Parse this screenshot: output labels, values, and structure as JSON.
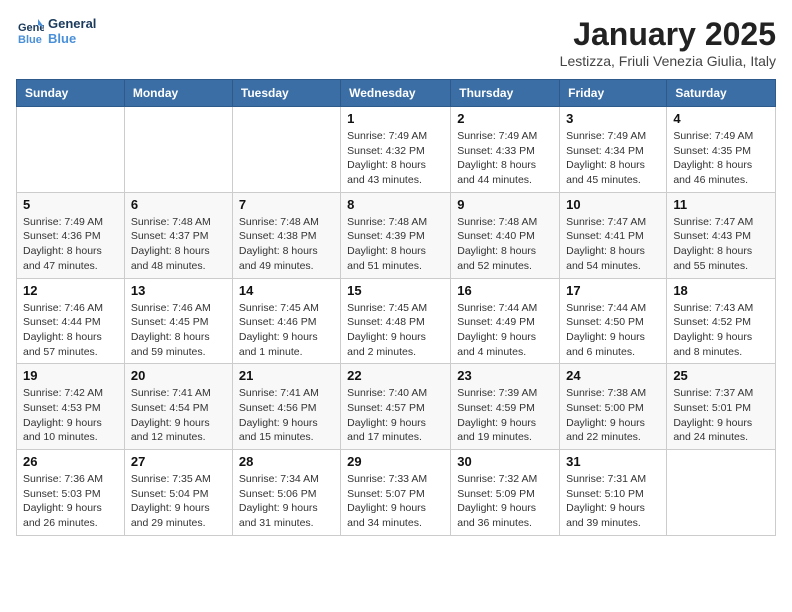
{
  "header": {
    "logo_line1": "General",
    "logo_line2": "Blue",
    "title": "January 2025",
    "subtitle": "Lestizza, Friuli Venezia Giulia, Italy"
  },
  "days_of_week": [
    "Sunday",
    "Monday",
    "Tuesday",
    "Wednesday",
    "Thursday",
    "Friday",
    "Saturday"
  ],
  "weeks": [
    [
      {
        "day": "",
        "info": ""
      },
      {
        "day": "",
        "info": ""
      },
      {
        "day": "",
        "info": ""
      },
      {
        "day": "1",
        "info": "Sunrise: 7:49 AM\nSunset: 4:32 PM\nDaylight: 8 hours and 43 minutes."
      },
      {
        "day": "2",
        "info": "Sunrise: 7:49 AM\nSunset: 4:33 PM\nDaylight: 8 hours and 44 minutes."
      },
      {
        "day": "3",
        "info": "Sunrise: 7:49 AM\nSunset: 4:34 PM\nDaylight: 8 hours and 45 minutes."
      },
      {
        "day": "4",
        "info": "Sunrise: 7:49 AM\nSunset: 4:35 PM\nDaylight: 8 hours and 46 minutes."
      }
    ],
    [
      {
        "day": "5",
        "info": "Sunrise: 7:49 AM\nSunset: 4:36 PM\nDaylight: 8 hours and 47 minutes."
      },
      {
        "day": "6",
        "info": "Sunrise: 7:48 AM\nSunset: 4:37 PM\nDaylight: 8 hours and 48 minutes."
      },
      {
        "day": "7",
        "info": "Sunrise: 7:48 AM\nSunset: 4:38 PM\nDaylight: 8 hours and 49 minutes."
      },
      {
        "day": "8",
        "info": "Sunrise: 7:48 AM\nSunset: 4:39 PM\nDaylight: 8 hours and 51 minutes."
      },
      {
        "day": "9",
        "info": "Sunrise: 7:48 AM\nSunset: 4:40 PM\nDaylight: 8 hours and 52 minutes."
      },
      {
        "day": "10",
        "info": "Sunrise: 7:47 AM\nSunset: 4:41 PM\nDaylight: 8 hours and 54 minutes."
      },
      {
        "day": "11",
        "info": "Sunrise: 7:47 AM\nSunset: 4:43 PM\nDaylight: 8 hours and 55 minutes."
      }
    ],
    [
      {
        "day": "12",
        "info": "Sunrise: 7:46 AM\nSunset: 4:44 PM\nDaylight: 8 hours and 57 minutes."
      },
      {
        "day": "13",
        "info": "Sunrise: 7:46 AM\nSunset: 4:45 PM\nDaylight: 8 hours and 59 minutes."
      },
      {
        "day": "14",
        "info": "Sunrise: 7:45 AM\nSunset: 4:46 PM\nDaylight: 9 hours and 1 minute."
      },
      {
        "day": "15",
        "info": "Sunrise: 7:45 AM\nSunset: 4:48 PM\nDaylight: 9 hours and 2 minutes."
      },
      {
        "day": "16",
        "info": "Sunrise: 7:44 AM\nSunset: 4:49 PM\nDaylight: 9 hours and 4 minutes."
      },
      {
        "day": "17",
        "info": "Sunrise: 7:44 AM\nSunset: 4:50 PM\nDaylight: 9 hours and 6 minutes."
      },
      {
        "day": "18",
        "info": "Sunrise: 7:43 AM\nSunset: 4:52 PM\nDaylight: 9 hours and 8 minutes."
      }
    ],
    [
      {
        "day": "19",
        "info": "Sunrise: 7:42 AM\nSunset: 4:53 PM\nDaylight: 9 hours and 10 minutes."
      },
      {
        "day": "20",
        "info": "Sunrise: 7:41 AM\nSunset: 4:54 PM\nDaylight: 9 hours and 12 minutes."
      },
      {
        "day": "21",
        "info": "Sunrise: 7:41 AM\nSunset: 4:56 PM\nDaylight: 9 hours and 15 minutes."
      },
      {
        "day": "22",
        "info": "Sunrise: 7:40 AM\nSunset: 4:57 PM\nDaylight: 9 hours and 17 minutes."
      },
      {
        "day": "23",
        "info": "Sunrise: 7:39 AM\nSunset: 4:59 PM\nDaylight: 9 hours and 19 minutes."
      },
      {
        "day": "24",
        "info": "Sunrise: 7:38 AM\nSunset: 5:00 PM\nDaylight: 9 hours and 22 minutes."
      },
      {
        "day": "25",
        "info": "Sunrise: 7:37 AM\nSunset: 5:01 PM\nDaylight: 9 hours and 24 minutes."
      }
    ],
    [
      {
        "day": "26",
        "info": "Sunrise: 7:36 AM\nSunset: 5:03 PM\nDaylight: 9 hours and 26 minutes."
      },
      {
        "day": "27",
        "info": "Sunrise: 7:35 AM\nSunset: 5:04 PM\nDaylight: 9 hours and 29 minutes."
      },
      {
        "day": "28",
        "info": "Sunrise: 7:34 AM\nSunset: 5:06 PM\nDaylight: 9 hours and 31 minutes."
      },
      {
        "day": "29",
        "info": "Sunrise: 7:33 AM\nSunset: 5:07 PM\nDaylight: 9 hours and 34 minutes."
      },
      {
        "day": "30",
        "info": "Sunrise: 7:32 AM\nSunset: 5:09 PM\nDaylight: 9 hours and 36 minutes."
      },
      {
        "day": "31",
        "info": "Sunrise: 7:31 AM\nSunset: 5:10 PM\nDaylight: 9 hours and 39 minutes."
      },
      {
        "day": "",
        "info": ""
      }
    ]
  ]
}
